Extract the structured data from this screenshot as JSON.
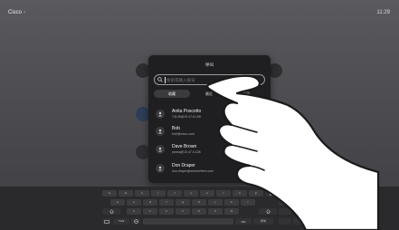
{
  "topbar": {
    "brand": "Cisco",
    "brand_chevron": "›",
    "time": "11:29"
  },
  "panel": {
    "title": "呼叫",
    "search": {
      "placeholder": "搜索或输入拨号"
    },
    "tabs": [
      {
        "label": "收藏"
      },
      {
        "label": "最近"
      },
      {
        "label": "目录"
      }
    ]
  },
  "contacts": [
    {
      "name": "Anita Poscotto",
      "address": "74145@10.47.6.108"
    },
    {
      "name": "Bob",
      "address": "bob@cisco.com"
    },
    {
      "name": "Dave Brown",
      "address": "yanna@10.47.6.108"
    },
    {
      "name": "Don Draper",
      "address": "don.draper@somewhere.com"
    }
  ],
  "keyboard": {
    "row1": [
      "q",
      "w",
      "e",
      "r",
      "t",
      "y",
      "u",
      "i",
      "o",
      "p"
    ],
    "row2": [
      "a",
      "s",
      "d",
      "f",
      "g",
      "h",
      "j",
      "k",
      "l"
    ],
    "row3": [
      "z",
      "x",
      "c",
      "v",
      "b",
      "n",
      "m"
    ],
    "bottom_left": "?123",
    "call_key": "呼叫"
  },
  "colors": {
    "background": "#4b4b4f",
    "panel": "#1f1f21",
    "keyboard": "#2a2a2c"
  }
}
